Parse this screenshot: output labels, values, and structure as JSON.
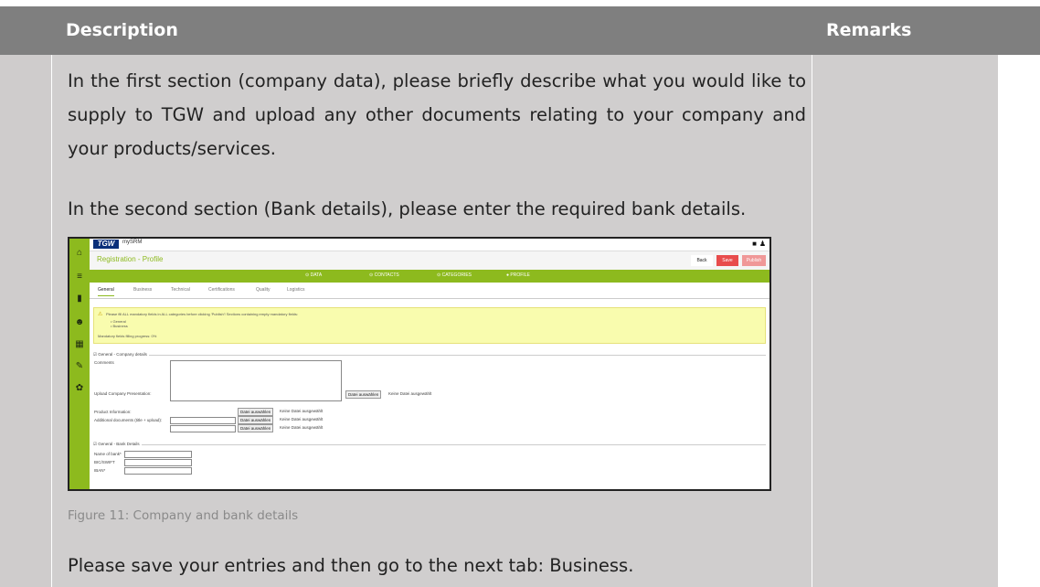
{
  "table": {
    "header_description": "Description",
    "header_remarks": "Remarks"
  },
  "content": {
    "para1": "In the first section (company data), please briefly describe what you would like to supply to TGW and upload any other documents relating to your company and your products/services.",
    "para2": "In the second section (Bank details), please enter the required bank details.",
    "caption": "Figure 11: Company and bank details",
    "para3": "Please save your entries and then go to the next tab: Business."
  },
  "screenshot": {
    "logo": "TGW",
    "app": "mySRM",
    "title": "Registration - Profile",
    "buttons": {
      "back": "Back",
      "save": "Save",
      "publish": "Publish"
    },
    "steps": [
      "DATA",
      "CONTACTS",
      "CATEGORIES",
      "PROFILE"
    ],
    "tabs": [
      "General",
      "Business",
      "Technical",
      "Certifications",
      "Quality",
      "Logistics"
    ],
    "warning": {
      "text": "Please fill ALL mandatory fields in ALL categories before clicking 'Publish'! Sections containing empty mandatory fields:",
      "items": [
        "General",
        "Business"
      ],
      "progress": "Mandatory fields filling progress: 0%"
    },
    "company": {
      "legend": "General - Company details",
      "comments": "Comments",
      "upload": "Upload Company Presentation:",
      "product": "Product Information:",
      "additional": "Additional documents (title + upload):",
      "choose": "Datei auswählen",
      "nofile": "Keine Datei ausgewählt"
    },
    "bank": {
      "legend": "General - Bank Details",
      "name": "Name of bank*",
      "bic": "BIC/SWIFT",
      "iban": "IBAN*"
    }
  }
}
